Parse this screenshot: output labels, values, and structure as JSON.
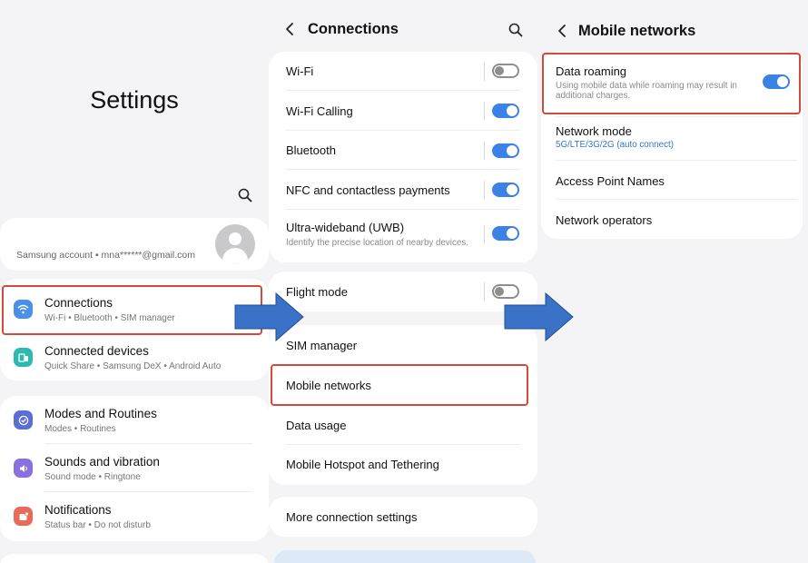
{
  "settings": {
    "title": "Settings",
    "account": {
      "text": "Samsung account  •  mna******@gmail.com"
    },
    "items": [
      {
        "title": "Connections",
        "sub": "Wi-Fi  •  Bluetooth  •  SIM manager",
        "color": "#4a8fe8",
        "icon": "wifi-icon"
      },
      {
        "title": "Connected devices",
        "sub": "Quick Share  •  Samsung DeX  •  Android Auto",
        "color": "#2fb8b0",
        "icon": "devices-icon"
      },
      {
        "title": "Modes and Routines",
        "sub": "Modes  •  Routines",
        "color": "#5a6fd6",
        "icon": "check-circle-icon"
      },
      {
        "title": "Sounds and vibration",
        "sub": "Sound mode  •  Ringtone",
        "color": "#8b6fe0",
        "icon": "speaker-icon"
      },
      {
        "title": "Notifications",
        "sub": "Status bar  •  Do not disturb",
        "color": "#ea6a5a",
        "icon": "bell-icon"
      }
    ]
  },
  "connections": {
    "title": "Connections",
    "toggles": [
      {
        "title": "Wi-Fi",
        "on": false
      },
      {
        "title": "Wi-Fi Calling",
        "on": true
      },
      {
        "title": "Bluetooth",
        "on": true
      },
      {
        "title": "NFC and contactless payments",
        "on": true
      },
      {
        "title": "Ultra-wideband (UWB)",
        "sub": "Identify the precise location of nearby devices.",
        "on": true
      }
    ],
    "flight_mode": {
      "title": "Flight mode",
      "on": false
    },
    "menu": [
      {
        "title": "SIM manager"
      },
      {
        "title": "Mobile networks"
      },
      {
        "title": "Data usage"
      },
      {
        "title": "Mobile Hotspot and Tethering"
      }
    ],
    "more": "More connection settings"
  },
  "mobile_networks": {
    "title": "Mobile networks",
    "data_roaming": {
      "title": "Data roaming",
      "sub": "Using mobile data while roaming may result in additional charges.",
      "on": true
    },
    "network_mode": {
      "title": "Network mode",
      "sub": "5G/LTE/3G/2G (auto connect)"
    },
    "apn": "Access Point Names",
    "operators": "Network operators"
  },
  "colors": {
    "accent": "#3b82e6",
    "highlight": "#d44a3a",
    "arrow": "#3a72c8",
    "link": "#2f77d0"
  }
}
